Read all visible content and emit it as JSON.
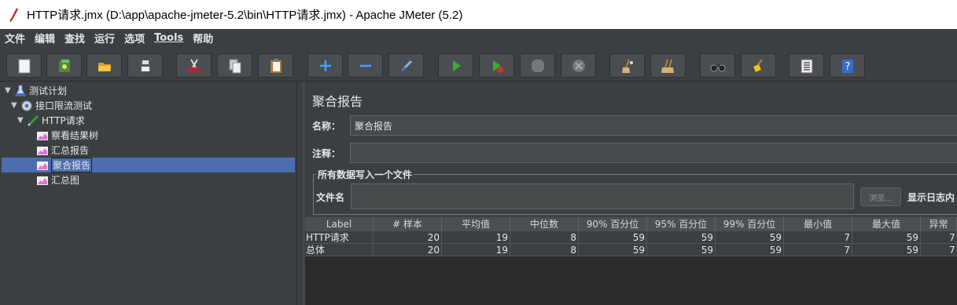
{
  "window": {
    "title": "HTTP请求.jmx (D:\\app\\apache-jmeter-5.2\\bin\\HTTP请求.jmx) - Apache JMeter (5.2)"
  },
  "menu": [
    "文件",
    "编辑",
    "查找",
    "运行",
    "选项",
    "Tools",
    "帮助"
  ],
  "toolbar": {
    "icons": [
      "new-icon",
      "templates-icon",
      "open-icon",
      "save-icon",
      "cut-icon",
      "copy-icon",
      "paste-icon",
      "expand-icon",
      "collapse-icon",
      "toggle-icon",
      "start-icon",
      "start-no-pause-icon",
      "stop-icon",
      "shutdown-icon",
      "clear-icon",
      "clear-all-icon",
      "search-icon",
      "reset-search-icon",
      "function-helper-icon",
      "help-icon"
    ]
  },
  "tree": {
    "items": [
      {
        "label": "测试计划",
        "icon": "test-plan-icon"
      },
      {
        "label": "接口限流测试",
        "icon": "thread-group-icon"
      },
      {
        "label": "HTTP请求",
        "icon": "http-sampler-icon"
      },
      {
        "label": "察看结果树",
        "icon": "listener-icon"
      },
      {
        "label": "汇总报告",
        "icon": "listener-icon"
      },
      {
        "label": "聚合报告",
        "icon": "listener-icon"
      },
      {
        "label": "汇总图",
        "icon": "listener-icon"
      }
    ]
  },
  "panel": {
    "title": "聚合报告",
    "name_label": "名称：",
    "name_value": "聚合报告",
    "comment_label": "注释：",
    "comment_value": "",
    "file_section_label": "所有数据写入一个文件",
    "filename_label": "文件名",
    "filename_value": "",
    "browse_label": "浏览...",
    "log_label": "显示日志内"
  },
  "table": {
    "headers": [
      "Label",
      "# 样本",
      "平均值",
      "中位数",
      "90% 百分位",
      "95% 百分位",
      "99% 百分位",
      "最小值",
      "最大值",
      "异常"
    ],
    "rows": [
      [
        "HTTP请求",
        "20",
        "19",
        "8",
        "59",
        "59",
        "59",
        "7",
        "59",
        "7"
      ],
      [
        "总体",
        "20",
        "19",
        "8",
        "59",
        "59",
        "59",
        "7",
        "59",
        "7"
      ]
    ]
  }
}
